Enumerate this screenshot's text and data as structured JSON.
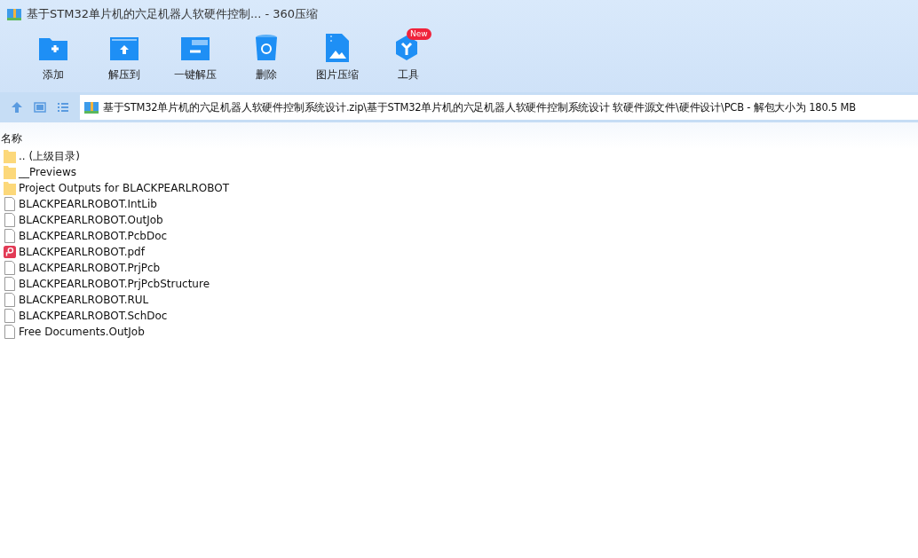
{
  "window": {
    "title": "基于STM32单片机的六足机器人软硬件控制... - 360压缩"
  },
  "toolbar": [
    {
      "label": "添加",
      "kind": "add"
    },
    {
      "label": "解压到",
      "kind": "extract-to"
    },
    {
      "label": "一键解压",
      "kind": "quick-extract"
    },
    {
      "label": "删除",
      "kind": "delete"
    },
    {
      "label": "图片压缩",
      "kind": "image"
    },
    {
      "label": "工具",
      "kind": "tools",
      "badge": "New"
    }
  ],
  "address_bar": {
    "path": "基于STM32单片机的六足机器人软硬件控制系统设计.zip\\基于STM32单片机的六足机器人软硬件控制系统设计 软硬件源文件\\硬件设计\\PCB - 解包大小为 180.5 MB"
  },
  "table": {
    "columns": [
      "名称"
    ],
    "rows": [
      {
        "name": ".. (上级目录)",
        "kind": "folder"
      },
      {
        "name": "__Previews",
        "kind": "folder"
      },
      {
        "name": "Project Outputs for BLACKPEARLROBOT",
        "kind": "folder"
      },
      {
        "name": "BLACKPEARLROBOT.IntLib",
        "kind": "file"
      },
      {
        "name": "BLACKPEARLROBOT.OutJob",
        "kind": "file"
      },
      {
        "name": "BLACKPEARLROBOT.PcbDoc",
        "kind": "file"
      },
      {
        "name": "BLACKPEARLROBOT.pdf",
        "kind": "pdf"
      },
      {
        "name": "BLACKPEARLROBOT.PrjPcb",
        "kind": "file"
      },
      {
        "name": "BLACKPEARLROBOT.PrjPcbStructure",
        "kind": "file"
      },
      {
        "name": "BLACKPEARLROBOT.RUL",
        "kind": "file"
      },
      {
        "name": "BLACKPEARLROBOT.SchDoc",
        "kind": "file"
      },
      {
        "name": "Free Documents.OutJob",
        "kind": "file"
      }
    ]
  }
}
